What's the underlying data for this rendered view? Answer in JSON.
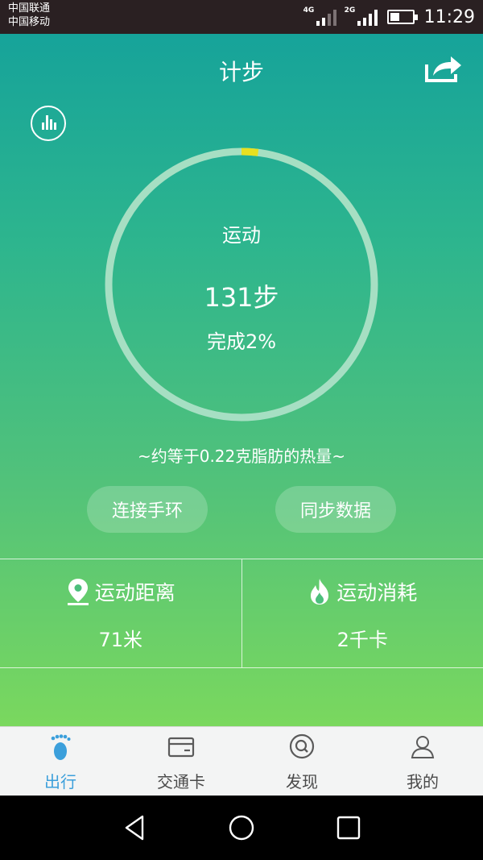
{
  "status_bar": {
    "carrier_1": "中国联通",
    "carrier_2": "中国移动",
    "network_1": "4G",
    "network_2": "2G",
    "battery_level": 0.45,
    "time": "11:29"
  },
  "header": {
    "title": "计步",
    "share_icon": "share-icon",
    "stats_icon": "bar-chart-icon"
  },
  "progress": {
    "label": "运动",
    "steps": "131步",
    "completion": "完成2%",
    "fraction": 0.02,
    "track_color": "#a6dfc3",
    "progress_color": "#e8e020"
  },
  "fat_equivalent": "~约等于0.22克脂肪的热量~",
  "buttons": {
    "connect": "连接手环",
    "sync": "同步数据"
  },
  "metrics": {
    "distance": {
      "label": "运动距离",
      "value": "71米",
      "icon": "location-pin-icon"
    },
    "calories": {
      "label": "运动消耗",
      "value": "2千卡",
      "icon": "flame-icon"
    }
  },
  "bottom_nav": {
    "active_color": "#3b9fdb",
    "tabs": [
      {
        "label": "出行",
        "icon": "footprint-icon",
        "active": true
      },
      {
        "label": "交通卡",
        "icon": "card-icon",
        "active": false
      },
      {
        "label": "发现",
        "icon": "discover-icon",
        "active": false
      },
      {
        "label": "我的",
        "icon": "profile-icon",
        "active": false
      }
    ]
  },
  "system_nav": [
    "back-icon",
    "home-icon",
    "recents-icon"
  ]
}
